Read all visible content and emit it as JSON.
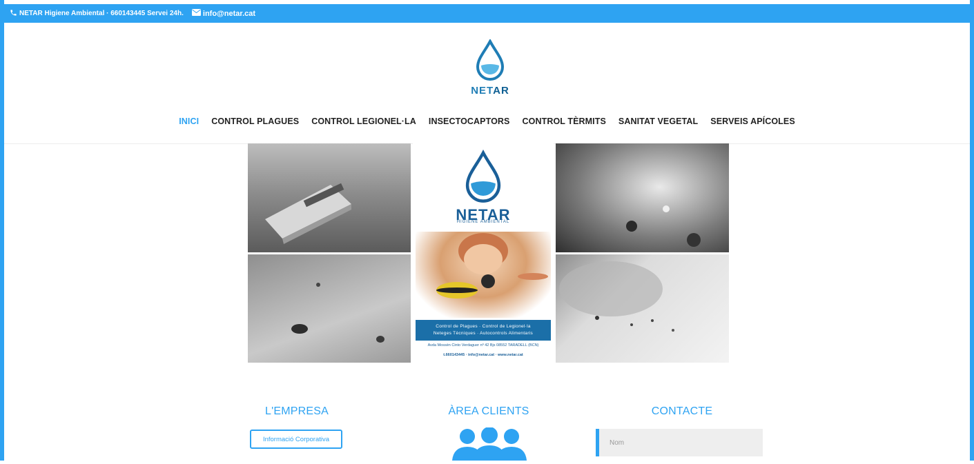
{
  "topbar": {
    "phone_text": "NETAR Higiene Ambiental · 660143445 Servei 24h.",
    "email_text": "info@netar.cat"
  },
  "logo": {
    "text_light": "NET",
    "text_dark": "AR"
  },
  "nav": {
    "items": [
      {
        "label": "INICI",
        "active": true
      },
      {
        "label": "CONTROL PLAGUES",
        "active": false
      },
      {
        "label": "CONTROL LEGIONEL·LA",
        "active": false
      },
      {
        "label": "INSECTOCAPTORS",
        "active": false
      },
      {
        "label": "CONTROL TÈRMITS",
        "active": false
      },
      {
        "label": "SANITAT VEGETAL",
        "active": false
      },
      {
        "label": "SERVEIS APÍCOLES",
        "active": false
      }
    ]
  },
  "poster": {
    "brand": "NETAR",
    "subtitle": "HIGIENE AMBIENTAL",
    "band_line1": "Control de Plagues · Control de Legionel·la",
    "band_line2": "Neteges Tècniques · Autocontrols Alimentaris",
    "address": "Avda Mossèn Cinto Verdaguer nº 42 Bjs 08552 TARADELL (BCN)",
    "contact": "t.660143445 · info@netar.cat · www.netar.cat"
  },
  "sections": {
    "empresa": {
      "title": "L'EMPRESA",
      "button": "Informació Corporativa"
    },
    "clients": {
      "title": "ÀREA CLIENTS"
    },
    "contacte": {
      "title": "CONTACTE",
      "name_placeholder": "Nom"
    }
  },
  "colors": {
    "accent": "#2ea3f2",
    "logo_blue": "#1f7db5"
  }
}
